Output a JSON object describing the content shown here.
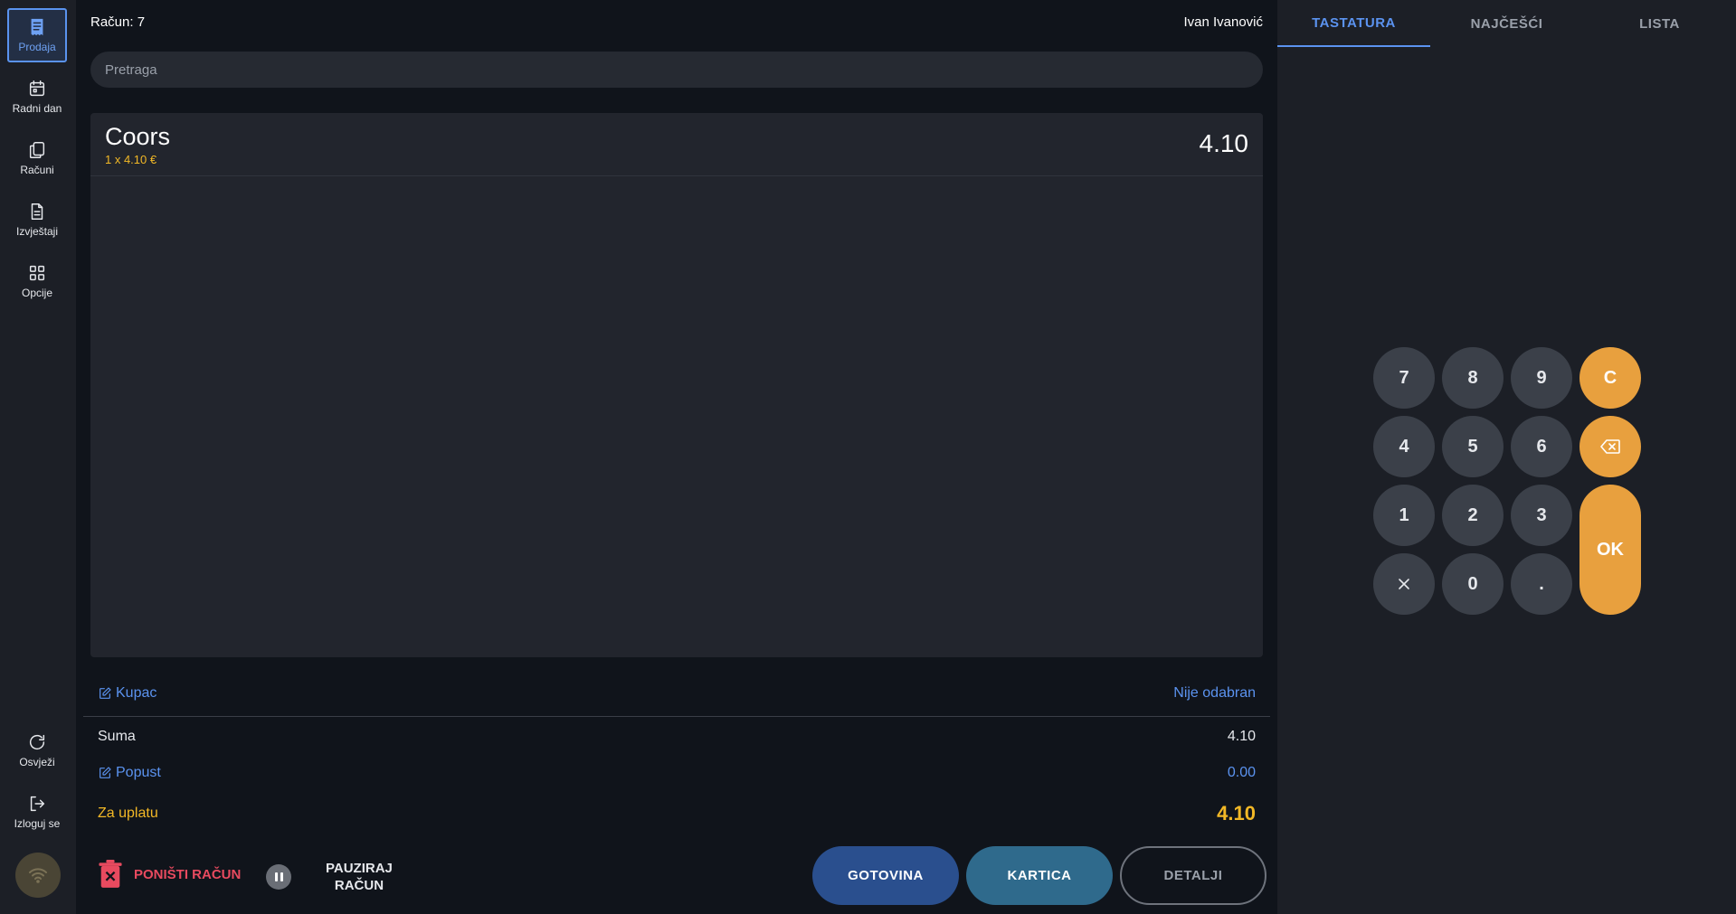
{
  "sidebar": {
    "items": [
      {
        "label": "Prodaja",
        "icon": "receipt-icon"
      },
      {
        "label": "Radni dan",
        "icon": "calendar-icon"
      },
      {
        "label": "Računi",
        "icon": "documents-icon"
      },
      {
        "label": "Izvještaji",
        "icon": "report-icon"
      },
      {
        "label": "Opcije",
        "icon": "grid-icon"
      }
    ],
    "bottom": [
      {
        "label": "Osvježi",
        "icon": "refresh-icon"
      },
      {
        "label": "Izloguj se",
        "icon": "logout-icon"
      }
    ]
  },
  "header": {
    "receipt_label": "Račun: 7",
    "user_name": "Ivan Ivanović"
  },
  "search": {
    "placeholder": "Pretraga",
    "value": ""
  },
  "items": [
    {
      "name": "Coors",
      "qty_line": "1 x 4.10 €",
      "total": "4.10"
    }
  ],
  "customer": {
    "label": "Kupac",
    "value": "Nije odabran"
  },
  "summary": {
    "sum_label": "Suma",
    "sum_value": "4.10",
    "discount_label": "Popust",
    "discount_value": "0.00",
    "to_pay_label": "Za uplatu",
    "to_pay_value": "4.10"
  },
  "actions": {
    "cancel": "PONIŠTI RAČUN",
    "pause_line1": "PAUZIRAJ",
    "pause_line2": "RAČUN",
    "cash": "GOTOVINA",
    "card": "KARTICA",
    "details": "DETALJI"
  },
  "tabs": [
    "TASTATURA",
    "NAJČEŠĆI",
    "LISTA"
  ],
  "keypad": {
    "digits": [
      "7",
      "8",
      "9",
      "4",
      "5",
      "6",
      "1",
      "2",
      "3",
      "0",
      "."
    ],
    "clear": "C",
    "ok": "OK"
  },
  "colors": {
    "accent": "#5b93f0",
    "highlight": "#f2b826",
    "keypad_action": "#e8a03e",
    "danger": "#e84a5f"
  }
}
